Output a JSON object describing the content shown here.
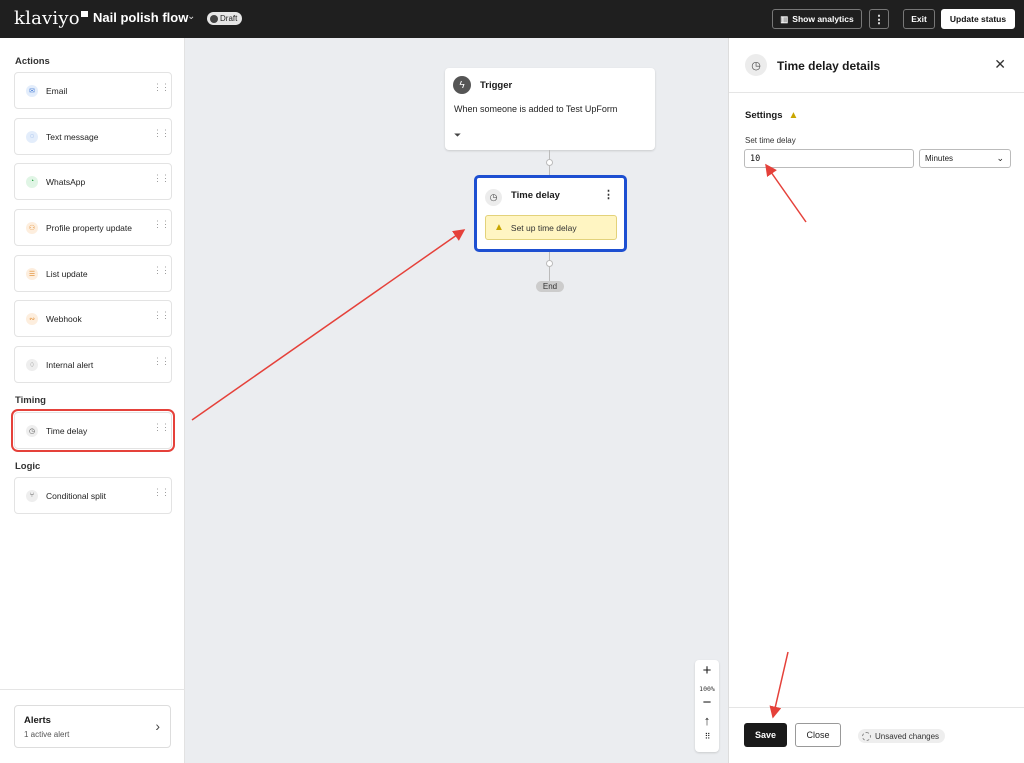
{
  "header": {
    "logo": "klaviyo",
    "flow_title": "Nail polish flow",
    "status_badge": "Draft",
    "show_analytics": "Show analytics",
    "exit": "Exit",
    "update_status": "Update status"
  },
  "sidebar": {
    "actions_heading": "Actions",
    "actions": [
      {
        "label": "Email",
        "icon": "mail-icon",
        "color": "#4a7fd6"
      },
      {
        "label": "Text message",
        "icon": "chat-icon",
        "color": "#4a7fd6"
      },
      {
        "label": "WhatsApp",
        "icon": "whatsapp-icon",
        "color": "#2ba84a"
      },
      {
        "label": "Profile property update",
        "icon": "person-icon",
        "color": "#e08a2c"
      },
      {
        "label": "List update",
        "icon": "list-icon",
        "color": "#e08a2c"
      },
      {
        "label": "Webhook",
        "icon": "webhook-icon",
        "color": "#e08a2c"
      },
      {
        "label": "Internal alert",
        "icon": "bell-icon",
        "color": "#666666"
      }
    ],
    "timing_heading": "Timing",
    "timing": [
      {
        "label": "Time delay",
        "icon": "clock-icon"
      }
    ],
    "logic_heading": "Logic",
    "logic": [
      {
        "label": "Conditional split",
        "icon": "split-icon"
      }
    ],
    "alerts_title": "Alerts",
    "alerts_sub": "1 active alert"
  },
  "canvas": {
    "trigger_title": "Trigger",
    "trigger_desc": "When someone is added to Test UpForm",
    "delay_title": "Time delay",
    "delay_warning": "Set up time delay",
    "end_label": "End",
    "zoom_level": "100%"
  },
  "panel": {
    "title": "Time delay details",
    "settings_heading": "Settings",
    "field_label": "Set time delay",
    "delay_value": "10",
    "unit": "Minutes",
    "save": "Save",
    "close": "Close",
    "unsaved": "Unsaved changes"
  },
  "colors": {
    "selected_border": "#1d4fd1",
    "annotation_red": "#e5413a",
    "warning_bg": "#fff5c2"
  }
}
